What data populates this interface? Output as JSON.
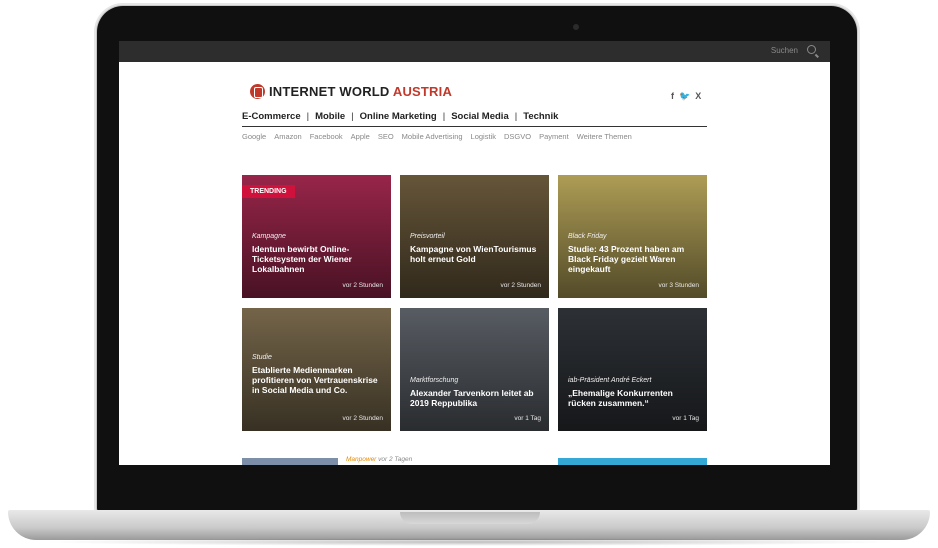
{
  "topbar": {
    "search_label": "Suchen"
  },
  "header": {
    "logo_main": "INTERNET WORLD",
    "logo_accent": "AUSTRIA",
    "social": [
      "f",
      "🐦",
      "X"
    ]
  },
  "nav": {
    "items": [
      "E-Commerce",
      "Mobile",
      "Online Marketing",
      "Social Media",
      "Technik"
    ]
  },
  "tags": [
    "Google",
    "Amazon",
    "Facebook",
    "Apple",
    "SEO",
    "Mobile Advertising",
    "Logistik",
    "DSGVO",
    "Payment",
    "Weitere Themen"
  ],
  "tiles": [
    {
      "badge": "TRENDING",
      "category": "Kampagne",
      "title": "Identum bewirbt Online-Ticketsystem der Wiener Lokalbahnen",
      "time": "vor 2 Stunden",
      "color": "#a0274e"
    },
    {
      "category": "Preisvorteil",
      "title": "Kampagne von WienTourismus holt erneut Gold",
      "time": "vor 2 Stunden",
      "color": "#6b5a3c"
    },
    {
      "category": "Black Friday",
      "title": "Studie: 43 Prozent haben am Black Friday gezielt Waren eingekauft",
      "time": "vor 3 Stunden",
      "color": "#b7a55a"
    },
    {
      "category": "Studie",
      "title": "Etablierte Medienmarken profitieren von Vertrauenskrise in Social Media und Co.",
      "time": "vor 2 Stunden",
      "color": "#7a6a4d"
    },
    {
      "category": "Marktforschung",
      "title": "Alexander Tarvenkorn leitet ab 2019 Reppublika",
      "time": "vor 1 Tag",
      "color": "#5c6168"
    },
    {
      "category": "iab-Präsident André Eckert",
      "title": "„Ehemalige Konkurrenten rücken zusammen.“",
      "time": "vor 1 Tag",
      "color": "#2f3338"
    }
  ],
  "strip": {
    "keyword": "Manpower",
    "time": "vor 2 Tagen"
  }
}
